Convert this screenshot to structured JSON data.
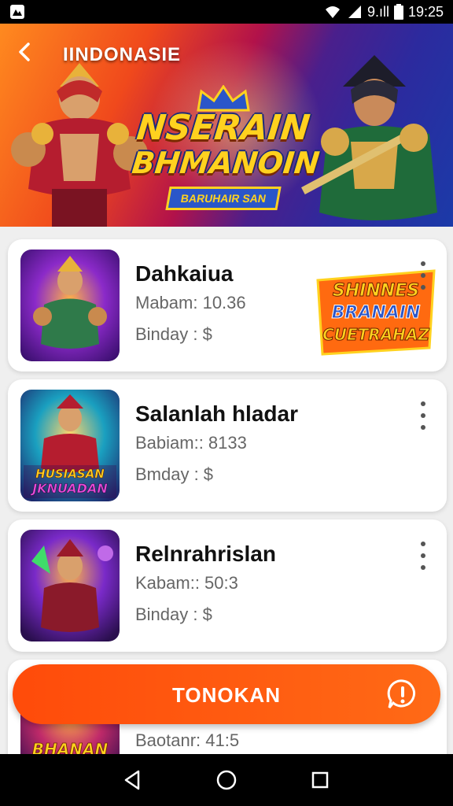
{
  "status_bar": {
    "carrier": "9.ıll",
    "time": "19:25"
  },
  "banner": {
    "title": "IINDONASIE",
    "logo_line1": "NSERAIN",
    "logo_line2": "BHMANOIN",
    "ribbon": "BARUHAIR SAN",
    "page_count": 3,
    "active_page": 1
  },
  "games": [
    {
      "title": "Dahkaiua",
      "meta1": "Mabam: 10.36",
      "meta2": "Binday : $"
    },
    {
      "title": "Salanlah hladar",
      "meta1": "Babiam:: 8133",
      "meta2": "Bmday : $"
    },
    {
      "title": "Relnrahrislan",
      "meta1": "Kabam:: 50:3",
      "meta2": "Binday : $"
    },
    {
      "title": "",
      "meta1": "Baotanr: 41:5",
      "meta2": ""
    }
  ],
  "promo": {
    "line1": "SHINNES",
    "line2": "BRANAIN",
    "line3": "CUETRAHAZ"
  },
  "thumb2_caption": {
    "line1": "HUSIASAN",
    "line2": "JKNUADAN"
  },
  "thumb4_caption": "BHANAN",
  "action_button": {
    "label": "TONOKAN"
  },
  "colors": {
    "accent": "#ff5a10",
    "banner_left": "#f0491c",
    "banner_right": "#2c2a9e"
  },
  "icons": {
    "back": "back-arrow-icon",
    "menu": "more-vert-icon",
    "support": "chat-alert-icon",
    "nav": [
      "back-triangle-icon",
      "home-circle-icon",
      "recents-square-icon"
    ]
  }
}
